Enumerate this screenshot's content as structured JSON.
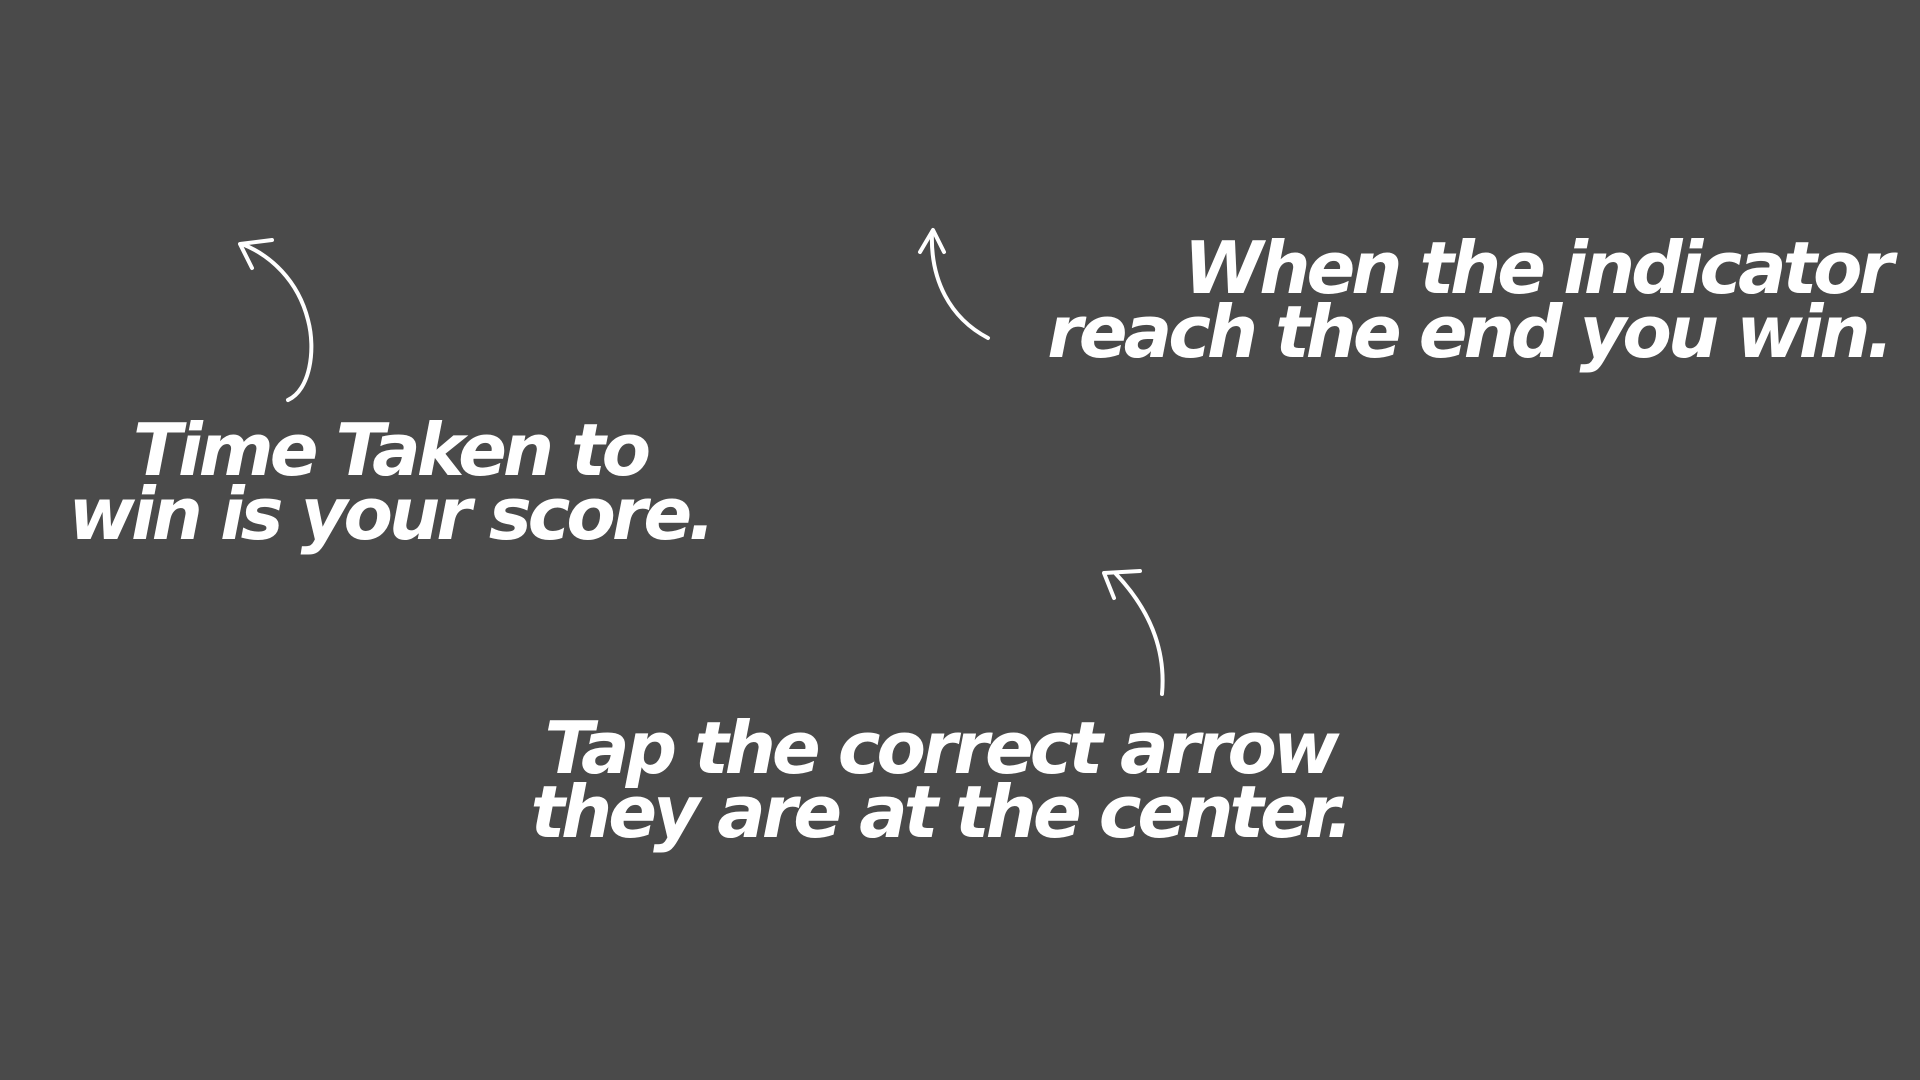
{
  "background_color": "#4a4a4a",
  "text_color": "#ffffff",
  "hints": {
    "score": {
      "line1": "Time Taken to",
      "line2": "win is your score."
    },
    "win": {
      "line1": "When the indicator",
      "line2": "reach the end you win."
    },
    "tap": {
      "line1": "Tap the correct arrow",
      "line2": "they are at the center."
    }
  },
  "icons": {
    "score_pointer": "curved-arrow-up-left-icon",
    "win_pointer": "curved-arrow-up-icon",
    "tap_pointer": "curved-arrow-up-left-icon"
  }
}
